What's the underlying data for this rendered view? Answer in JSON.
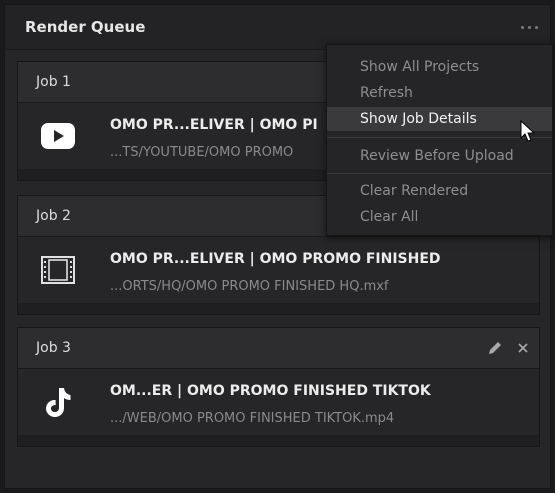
{
  "panel": {
    "title": "Render Queue"
  },
  "jobs": [
    {
      "label": "Job 1",
      "name": "OMO PR...ELIVER | OMO PI",
      "path": "...TS/YOUTUBE/OMO PROMO",
      "icon": "youtube-icon"
    },
    {
      "label": "Job 2",
      "name": "OMO PR...ELIVER | OMO PROMO FINISHED",
      "path": "...ORTS/HQ/OMO PROMO FINISHED HQ.mxf",
      "icon": "film-strip-icon"
    },
    {
      "label": "Job 3",
      "name": "OM...ER | OMO PROMO FINISHED TIKTOK",
      "path": ".../WEB/OMO PROMO FINISHED TIKTOK.mp4",
      "icon": "tiktok-icon"
    }
  ],
  "menu": {
    "items": [
      {
        "label": "Show All Projects"
      },
      {
        "label": "Refresh"
      },
      {
        "label": "Show Job Details"
      },
      {
        "label": "Review Before Upload"
      },
      {
        "label": "Clear Rendered"
      },
      {
        "label": "Clear All"
      }
    ],
    "highlighted": "Show Job Details"
  }
}
